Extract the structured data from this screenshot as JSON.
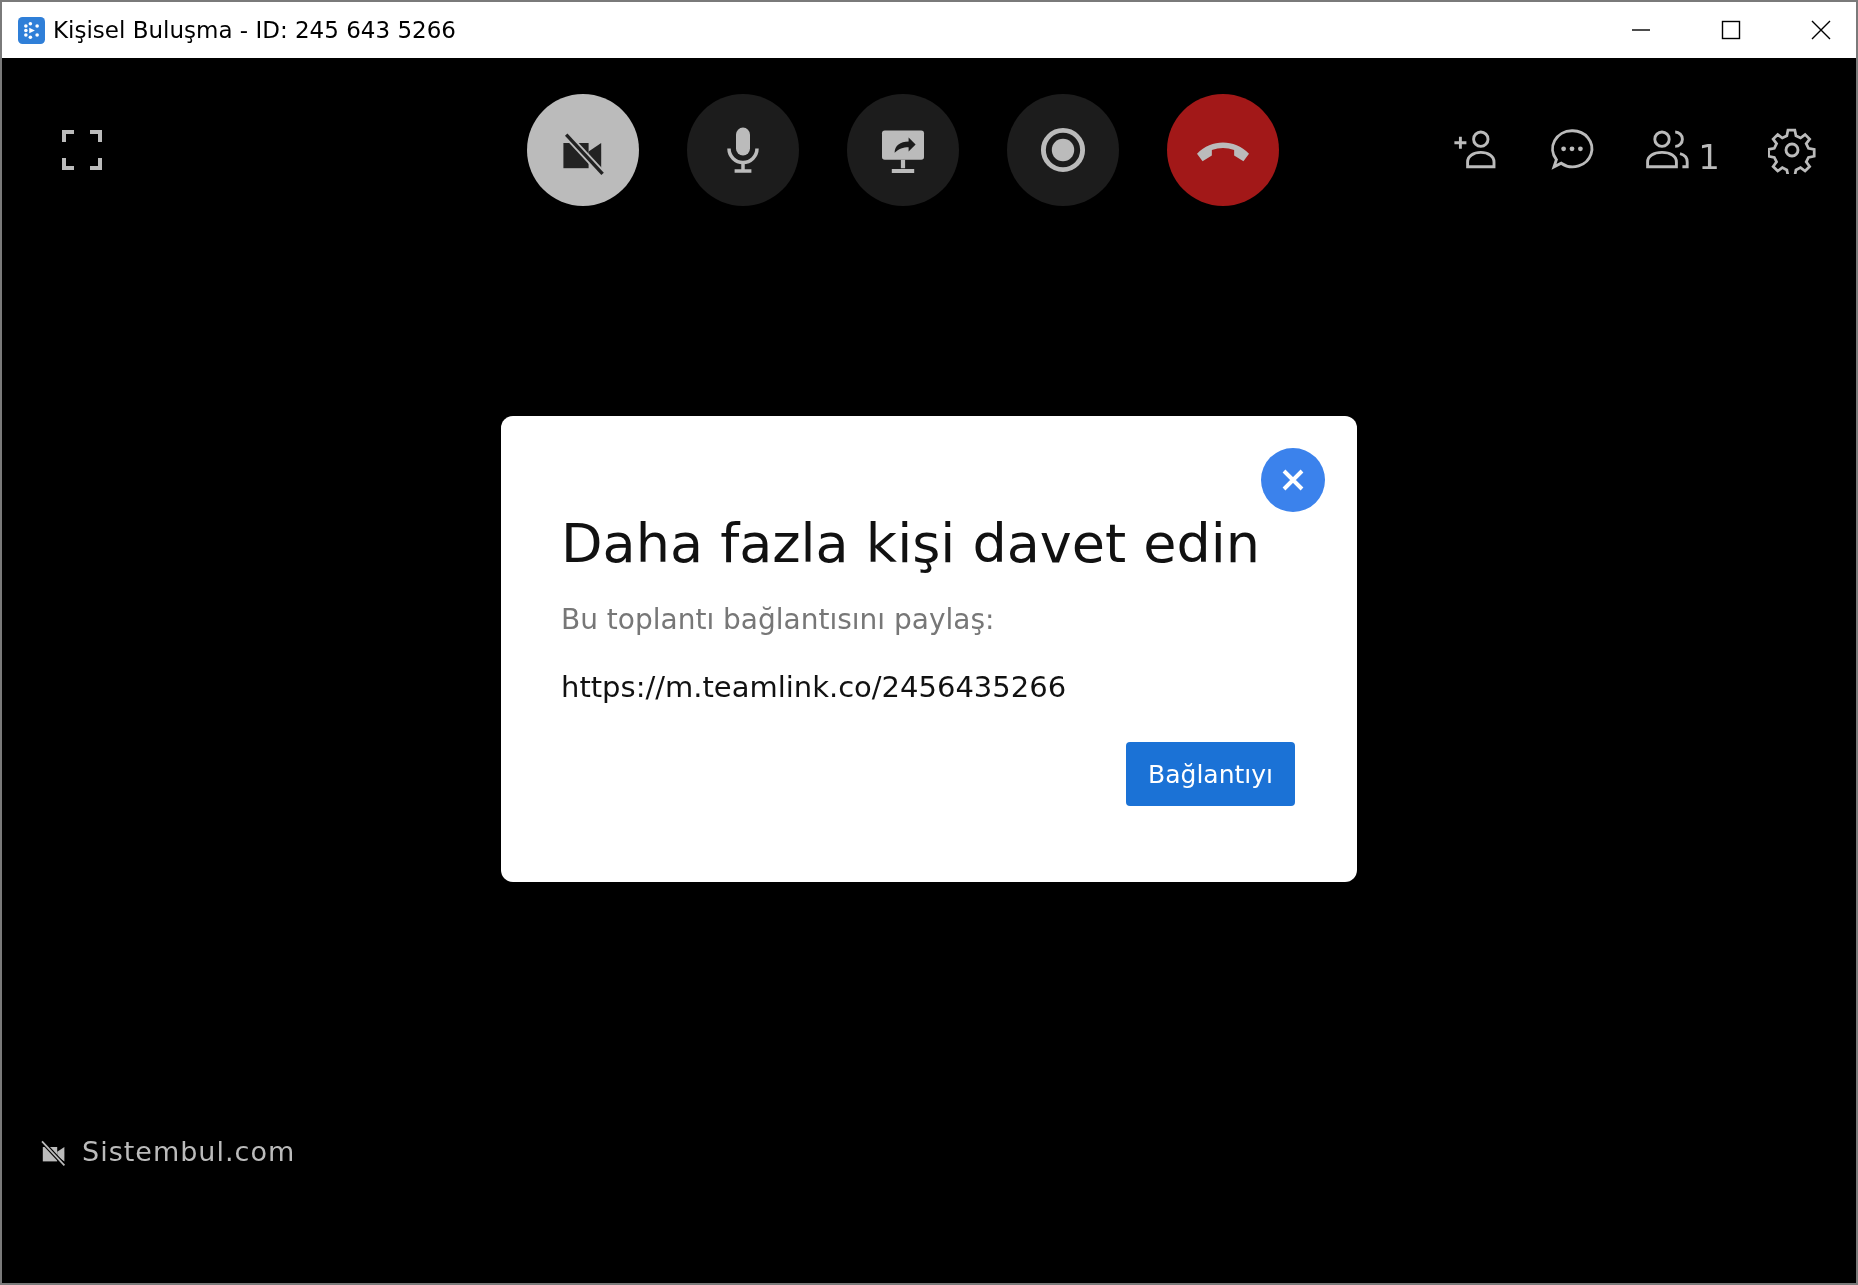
{
  "window": {
    "title": "Kişisel Buluşma - ID: 245 643 5266"
  },
  "call_controls": [
    {
      "kind": "camera",
      "on": false
    },
    {
      "kind": "microphone",
      "on": true
    },
    {
      "kind": "share"
    },
    {
      "kind": "record"
    },
    {
      "kind": "hangup"
    }
  ],
  "side_tools": [
    {
      "kind": "invite"
    },
    {
      "kind": "chat"
    },
    {
      "kind": "participants",
      "count": "1"
    },
    {
      "kind": "settings"
    }
  ],
  "participant": {
    "name": "Sistembul.com",
    "camera_on": false
  },
  "dialog": {
    "title": "Daha fazla kişi davet edin",
    "subtitle": "Bu toplantı bağlantısını paylaş:",
    "link": "https://m.teamlink.co/2456435266",
    "button": "Bağlantıyı"
  }
}
